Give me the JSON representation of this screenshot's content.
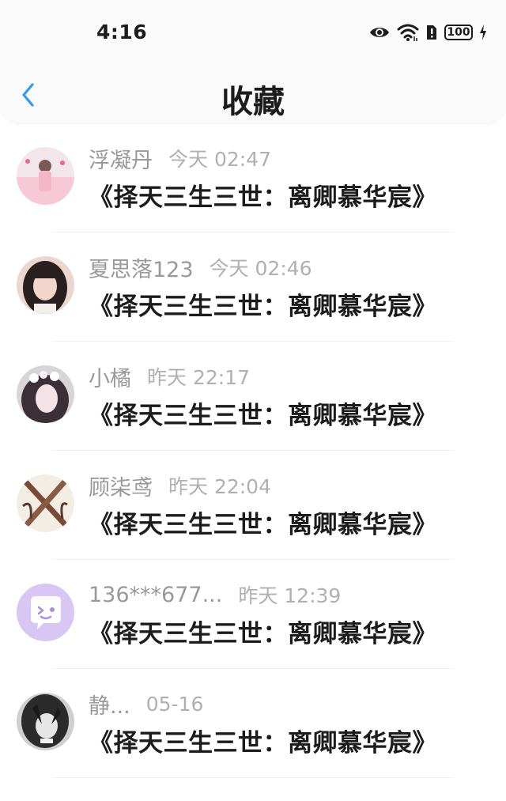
{
  "status_bar": {
    "time": "4:16",
    "battery": "100"
  },
  "nav": {
    "title": "收藏",
    "back_icon": "chevron-left-icon"
  },
  "colors": {
    "accent": "#2f9cf0",
    "text_primary": "#1c1c1c",
    "text_secondary": "#999999",
    "timestamp": "#b0b0b0"
  },
  "favorites": [
    {
      "user": "浮凝丹",
      "time": "今天 02:47",
      "title": "《择天三生三世：离卿慕华宸》"
    },
    {
      "user": "夏思落123",
      "time": "今天 02:46",
      "title": "《择天三生三世：离卿慕华宸》"
    },
    {
      "user": "小橘",
      "time": "昨天 22:17",
      "title": "《择天三生三世：离卿慕华宸》"
    },
    {
      "user": "顾柒鸢",
      "time": "昨天 22:04",
      "title": "《择天三生三世：离卿慕华宸》"
    },
    {
      "user": "136***677...",
      "time": "昨天 12:39",
      "title": "《择天三生三世：离卿慕华宸》"
    },
    {
      "user": "静...",
      "time": "05-16",
      "title": "《择天三生三世：离卿慕华宸》"
    }
  ]
}
